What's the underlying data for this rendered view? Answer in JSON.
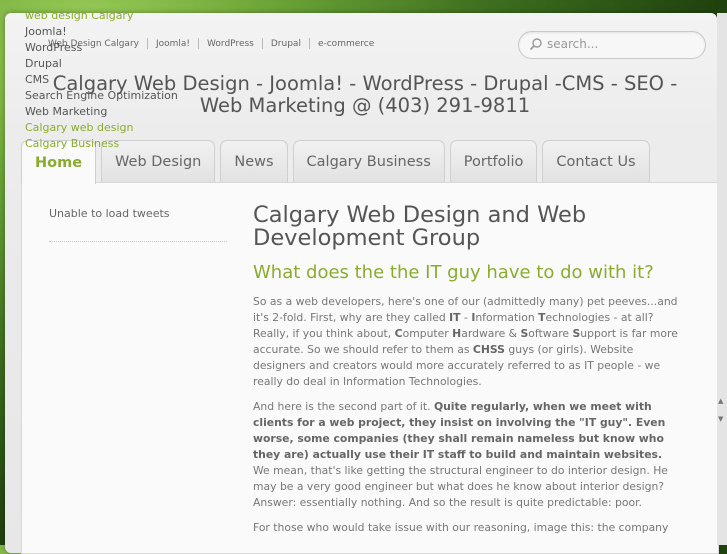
{
  "side_list": [
    {
      "label": "web design Calgary",
      "accent": true
    },
    {
      "label": "Joomla!",
      "accent": false
    },
    {
      "label": "WordPress",
      "accent": false
    },
    {
      "label": "Drupal",
      "accent": false
    },
    {
      "label": "CMS",
      "accent": false
    },
    {
      "label": "Search Engine Optimization",
      "accent": false
    },
    {
      "label": "Web Marketing",
      "accent": false
    },
    {
      "label": "Calgary web design",
      "accent": true
    },
    {
      "label": "Calgary Business",
      "accent": true
    }
  ],
  "topnav": [
    "Web Design Calgary",
    "Joomla!",
    "WordPress",
    "Drupal",
    "e-commerce"
  ],
  "search": {
    "placeholder": "search..."
  },
  "site_title_line1": "Calgary Web Design - Joomla! - WordPress - Drupal -CMS - SEO -",
  "site_title_line2": "Web Marketing @ (403) 291-9811",
  "tabs": [
    "Home",
    "Web Design",
    "News",
    "Calgary Business",
    "Portfolio",
    "Contact Us"
  ],
  "active_tab": "Home",
  "sidebar": {
    "tweets_status": "Unable to load tweets"
  },
  "article": {
    "title": "Calgary Web Design and Web Development Group",
    "subtitle": "What does the the IT guy have to do with it?",
    "p1": {
      "a": "So as a web developers, here's one of our (admittedly many) pet peeves...and it's 2-fold. First, why are they called ",
      "b1": "IT",
      "c": " - ",
      "b2": "I",
      "d": "nformation ",
      "b3": "T",
      "e": "echnologies - at all? Really, if you think about, ",
      "b4": "C",
      "f": "omputer ",
      "b5": "H",
      "g": "ardware & ",
      "b6": "S",
      "h": "oftware ",
      "b7": "S",
      "i": "upport is far more accurate.  So we should refer to them as ",
      "b8": "CHSS",
      "j": " guys (or girls).  Website designers and creators would more accurately referred to as IT people - we really do deal in Information Technologies."
    },
    "p2": {
      "a": "And here is the second part of it. ",
      "b": "Quite regularly, when we meet with clients for a web project, they insist on involving the \"IT guy\". Even worse, some companies (they shall remain nameless but know who they are) actually use their IT staff to build and maintain websites.",
      "c": " We mean, that's like getting the structural engineer to do interior design. He may be a very good engineer but what does he know about interior design? Answer: essentially nothing. And so the result is quite predictable: poor."
    },
    "p3": "For those who would take issue with our reasoning, image this:  the company"
  },
  "colors": {
    "accent": "#8aac2e",
    "text": "#777777",
    "heading": "#555555"
  }
}
